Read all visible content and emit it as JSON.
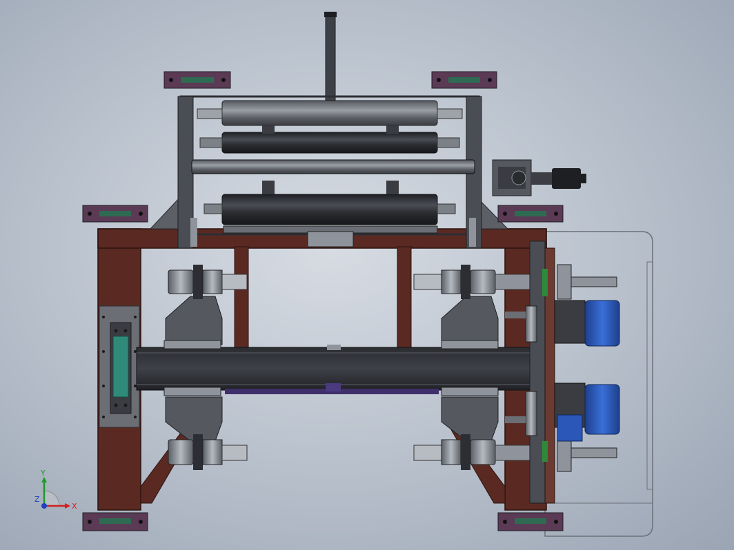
{
  "viewport": {
    "background_top": "#d7dce3",
    "background_bottom": "#9aa4b3"
  },
  "colors": {
    "frame_maroon": "#5a2a22",
    "frame_dark": "#3b1b16",
    "steel_dark": "#3a3d44",
    "steel_mid": "#5c6068",
    "steel_light": "#8f949c",
    "roller": "#2e3035",
    "motor_blue": "#2a57b8",
    "foot_purple": "#5b3a55",
    "teal": "#2f8a7a",
    "green": "#2e8a3a"
  },
  "triad": {
    "x_label": "X",
    "y_label": "Y",
    "z_label": "Z",
    "x_color": "#d12020",
    "y_color": "#1f9a2a",
    "z_color": "#2040c0"
  }
}
